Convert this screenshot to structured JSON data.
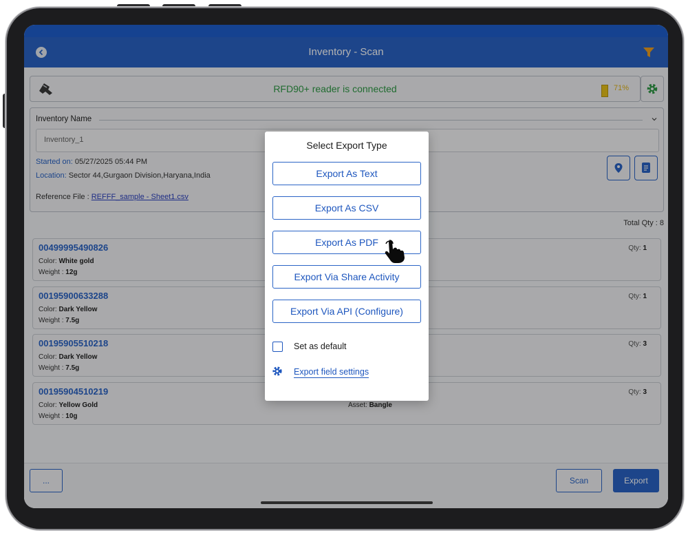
{
  "header": {
    "title": "Inventory - Scan"
  },
  "reader": {
    "status_text": "RFD90+ reader is connected",
    "battery_text": "71%"
  },
  "inventory": {
    "name_label": "Inventory Name",
    "name_value": "Inventory_1",
    "started_label": "Started on:",
    "started_value": "05/27/2025 05:44 PM",
    "location_label": "Location:",
    "location_value": "Sector 44,Gurgaon Division,Haryana,India",
    "reference_label": "Reference File :",
    "reference_value": "REFFF_sample - Sheet1.csv"
  },
  "total_qty": "Total Qty : 8",
  "items": [
    {
      "code": "00499995490826",
      "color_label": "Color:",
      "color": "White gold",
      "weight_label": "Weight :",
      "weight": "12g",
      "qty_label": "Qty:",
      "qty": "1",
      "asset_label": "",
      "asset": ""
    },
    {
      "code": "00195900633288",
      "color_label": "Color:",
      "color": "Dark Yellow",
      "weight_label": "Weight :",
      "weight": "7.5g",
      "qty_label": "Qty:",
      "qty": "1",
      "asset_label": "",
      "asset": ""
    },
    {
      "code": "00195905510218",
      "color_label": "Color:",
      "color": "Dark Yellow",
      "weight_label": "Weight :",
      "weight": "7.5g",
      "qty_label": "Qty:",
      "qty": "3",
      "asset_label": "",
      "asset": ""
    },
    {
      "code": "00195904510219",
      "color_label": "Color:",
      "color": "Yellow Gold",
      "weight_label": "Weight :",
      "weight": "10g",
      "qty_label": "Qty:",
      "qty": "3",
      "asset_label": "Asset:",
      "asset": "Bangle"
    }
  ],
  "bottom": {
    "more_label": "...",
    "scan_label": "Scan",
    "export_label": "Export"
  },
  "modal": {
    "title": "Select Export Type",
    "options": [
      "Export As Text",
      "Export As CSV",
      "Export As PDF",
      "Export Via Share Activity",
      "Export Via API (Configure)"
    ],
    "default_label": "Set as default",
    "field_settings_label": "Export field settings"
  },
  "colors": {
    "brand_blue": "#2a64c6",
    "connected_green": "#2f9a45",
    "battery_yellow": "#e8c21a"
  },
  "icons": [
    "back-icon",
    "filter-icon",
    "rfid-reader-icon",
    "battery-icon",
    "gear-icon",
    "chevron-down-icon",
    "location-pin-icon",
    "document-icon",
    "hand-pointer-icon"
  ]
}
